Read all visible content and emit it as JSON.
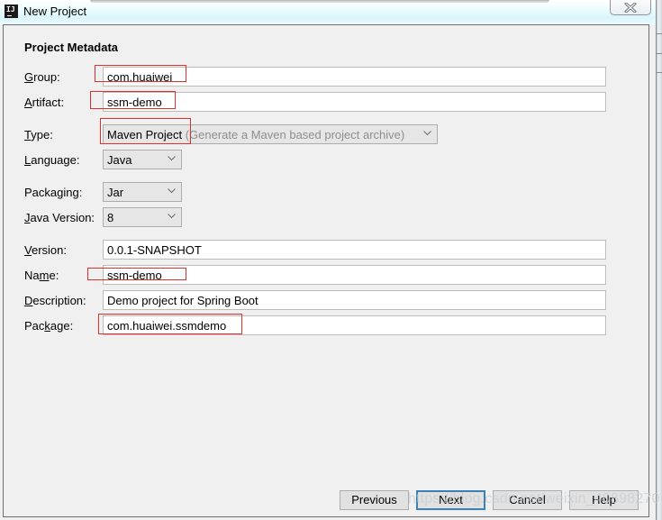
{
  "window": {
    "title": "New Project",
    "app_icon_text": "IJ",
    "close_icon": "close-icon"
  },
  "section": {
    "title": "Project Metadata"
  },
  "fields": {
    "group": {
      "label_pre": "",
      "label_key": "G",
      "label_post": "roup:",
      "value": "com.huaiwei"
    },
    "artifact": {
      "label_pre": "",
      "label_key": "A",
      "label_post": "rtifact:",
      "value": "ssm-demo"
    },
    "type": {
      "label_pre": "",
      "label_key": "T",
      "label_post": "ype:",
      "value": "Maven Project",
      "hint": "(Generate a Maven based project archive)"
    },
    "language": {
      "label_pre": "",
      "label_key": "L",
      "label_post": "anguage:",
      "value": "Java"
    },
    "packaging": {
      "label_pre": "Packa",
      "label_key": "g",
      "label_post": "ing:",
      "value": "Jar"
    },
    "java_version": {
      "label_pre": "",
      "label_key": "J",
      "label_post": "ava Version:",
      "value": "8"
    },
    "version": {
      "label_pre": "",
      "label_key": "V",
      "label_post": "ersion:",
      "value": "0.0.1-SNAPSHOT"
    },
    "name": {
      "label_pre": "Na",
      "label_key": "m",
      "label_post": "e:",
      "value": "ssm-demo"
    },
    "description": {
      "label_pre": "",
      "label_key": "D",
      "label_post": "escription:",
      "value": "Demo project for Spring Boot"
    },
    "package": {
      "label_pre": "Pac",
      "label_key": "k",
      "label_post": "age:",
      "value": "com.huaiwei.ssmdemo"
    }
  },
  "buttons": {
    "previous": "Previous",
    "next": "Next",
    "cancel": "Cancel",
    "help": "Help"
  },
  "watermark": "https://blog.csdn.net/weixin_40898270",
  "colors": {
    "annotation_red": "#e0302e",
    "default_button_border": "#3c7fb1",
    "panel_bg": "#f0f0f0"
  }
}
